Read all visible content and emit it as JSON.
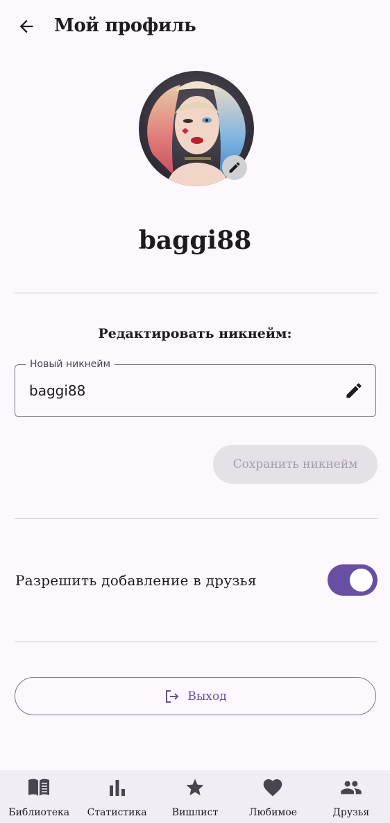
{
  "header": {
    "title": "Мой профиль",
    "back_icon": "arrow-left-icon"
  },
  "profile": {
    "username": "baggi88",
    "edit_avatar_icon": "pencil-icon"
  },
  "nickname_section": {
    "label": "Редактировать никнейм:",
    "field_label": "Новый никнейм",
    "field_value": "baggi88",
    "edit_icon": "pencil-icon",
    "save_label": "Сохранить никнейм",
    "save_enabled": false
  },
  "settings": {
    "allow_friends_label": "Разрешить добавление в друзья",
    "allow_friends_enabled": true
  },
  "logout": {
    "label": "Выход",
    "icon": "logout-icon"
  },
  "nav": {
    "items": [
      {
        "label": "Библиотека",
        "icon": "book-icon"
      },
      {
        "label": "Статистика",
        "icon": "bar-chart-icon"
      },
      {
        "label": "Вишлист",
        "icon": "star-icon"
      },
      {
        "label": "Любимое",
        "icon": "heart-icon"
      },
      {
        "label": "Друзья",
        "icon": "people-icon"
      }
    ]
  },
  "colors": {
    "background": "#fdf8fd",
    "accent": "#6750a4",
    "nav_background": "#f2ecf4",
    "disabled_button": "#e6e1e6"
  }
}
